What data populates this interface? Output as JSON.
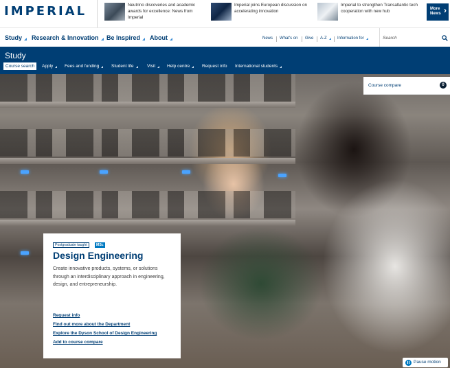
{
  "header": {
    "logo": "IMPERIAL",
    "news": [
      {
        "text": "Neutrino discoveries and academic awards for excellence: News from Imperial"
      },
      {
        "text": "Imperial joins European discussion on accelerating innovation"
      },
      {
        "text": "Imperial to strengthen Transatlantic tech cooperation with new hub"
      }
    ],
    "more_news_line1": "More",
    "more_news_line2": "News",
    "more_news_chevron": "›"
  },
  "main_nav": {
    "items": [
      {
        "label": "Study"
      },
      {
        "label": "Research & Innovation"
      },
      {
        "label": "Be Inspired"
      },
      {
        "label": "About"
      }
    ],
    "utility": [
      {
        "label": "News"
      },
      {
        "label": "What's on"
      },
      {
        "label": "Give"
      },
      {
        "label": "A-Z"
      },
      {
        "label": "Information for"
      }
    ],
    "search_placeholder": "Search"
  },
  "study_nav": {
    "title": "Study",
    "items": [
      {
        "label": "Course search"
      },
      {
        "label": "Apply"
      },
      {
        "label": "Fees and funding"
      },
      {
        "label": "Student life"
      },
      {
        "label": "Visit"
      },
      {
        "label": "Help centre"
      },
      {
        "label": "Request info"
      },
      {
        "label": "International students"
      }
    ]
  },
  "course_compare": {
    "label": "Course compare",
    "count": "0"
  },
  "course": {
    "level_badge": "Postgraduate taught",
    "type_badge": "MSc",
    "title": "Design Engineering",
    "description": "Create innovative products, systems, or solutions through an interdisciplinary approach in engineering, design, and entrepreneurship.",
    "links": [
      {
        "label": "Request info"
      },
      {
        "label": "Find out more about the Department"
      },
      {
        "label": "Explore the Dyson School of Design Engineering"
      },
      {
        "label": "Add to course compare"
      }
    ]
  },
  "pause_motion": {
    "label": "Pause motion"
  },
  "colors": {
    "brand_navy": "#003e74",
    "accent_blue": "#0079c1"
  }
}
